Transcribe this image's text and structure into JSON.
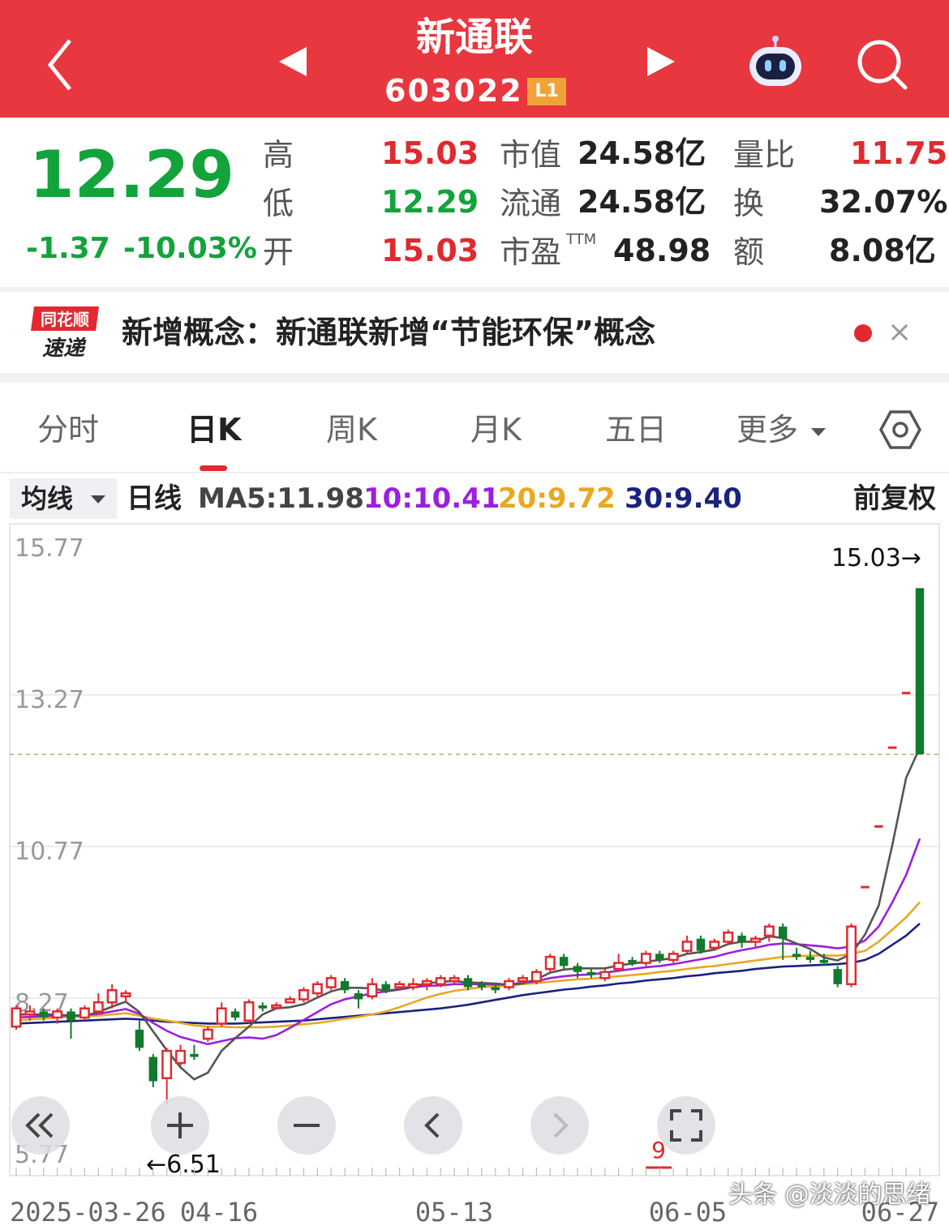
{
  "header": {
    "stock_name": "新通联",
    "stock_code": "603022",
    "level_badge": "L1",
    "back_icon": "back-chevron-icon",
    "prev_icon": "prev-triangle-icon",
    "next_icon": "next-triangle-icon",
    "robot_icon": "ai-robot-icon",
    "search_icon": "search-icon",
    "bg_color": "#e8373e"
  },
  "quote": {
    "last_price": "12.29",
    "change": "-1.37",
    "change_pct": "-10.03%",
    "high_label": "高",
    "high": "15.03",
    "low_label": "低",
    "low": "12.29",
    "open_label": "开",
    "open": "15.03",
    "mktcap_label": "市值",
    "mktcap": "24.58亿",
    "float_label": "流通",
    "float_cap": "24.58亿",
    "pe_label": "市盈",
    "pe_sup": "TTM",
    "pe": "48.98",
    "vol_ratio_label": "量比",
    "vol_ratio": "11.75",
    "turnover_label": "换",
    "turnover": "32.07%",
    "amount_label": "额",
    "amount": "8.08亿",
    "up_color": "#e02a2f",
    "down_color": "#13a33b"
  },
  "news": {
    "logo_top": "同花顺",
    "logo_bottom": "速递",
    "text": "新增概念：新通联新增“节能环保”概念",
    "close_glyph": "×"
  },
  "tabs": [
    {
      "label": "分时",
      "active": false
    },
    {
      "label": "日K",
      "active": true
    },
    {
      "label": "周K",
      "active": false
    },
    {
      "label": "月K",
      "active": false
    },
    {
      "label": "五日",
      "active": false
    },
    {
      "label": "更多",
      "active": false
    }
  ],
  "ma_bar": {
    "selector": "均线",
    "period": "日线",
    "ma5": "MA5:11.98",
    "ma10": "10:10.41",
    "ma20": "20:9.72",
    "ma30": "30:9.40",
    "adjust": "前复权",
    "ma5_color": "#555555",
    "ma10_color": "#9b1fe0",
    "ma20_color": "#e8a820",
    "ma30_color": "#1a2280"
  },
  "chart_data": {
    "type": "candlestick",
    "y_ticks": [
      "15.77",
      "13.27",
      "10.77",
      "8.27",
      "5.77"
    ],
    "ylim": [
      5.77,
      15.77
    ],
    "x_labels": [
      "2025-03-26",
      "04-16",
      "05-13",
      "06-05",
      "06-27"
    ],
    "max_label": "15.03→",
    "min_label": "←6.51",
    "last_close_line": 12.29,
    "marker": "9",
    "candles": [
      [
        7.8,
        8.1,
        7.75,
        8.15
      ],
      [
        8.0,
        8.05,
        7.9,
        8.15
      ],
      [
        8.05,
        7.95,
        7.9,
        8.1
      ],
      [
        7.95,
        8.05,
        7.85,
        8.1
      ],
      [
        8.05,
        7.9,
        7.6,
        8.1
      ],
      [
        7.95,
        8.1,
        7.9,
        8.15
      ],
      [
        8.05,
        8.2,
        8.0,
        8.35
      ],
      [
        8.2,
        8.4,
        8.1,
        8.5
      ],
      [
        8.3,
        8.35,
        8.2,
        8.4
      ],
      [
        7.75,
        7.45,
        7.4,
        7.9
      ],
      [
        7.3,
        6.9,
        6.8,
        7.35
      ],
      [
        6.95,
        7.4,
        6.51,
        7.45
      ],
      [
        7.2,
        7.4,
        7.15,
        7.5
      ],
      [
        7.35,
        7.3,
        7.25,
        7.5
      ],
      [
        7.6,
        7.75,
        7.55,
        7.8
      ],
      [
        7.85,
        8.1,
        7.8,
        8.2
      ],
      [
        8.05,
        7.95,
        7.9,
        8.1
      ],
      [
        7.9,
        8.2,
        7.85,
        8.25
      ],
      [
        8.15,
        8.1,
        8.05,
        8.2
      ],
      [
        8.15,
        8.15,
        8.1,
        8.2
      ],
      [
        8.2,
        8.25,
        8.2,
        8.3
      ],
      [
        8.25,
        8.4,
        8.2,
        8.45
      ],
      [
        8.35,
        8.5,
        8.3,
        8.55
      ],
      [
        8.45,
        8.6,
        8.4,
        8.65
      ],
      [
        8.55,
        8.4,
        8.35,
        8.6
      ],
      [
        8.35,
        8.25,
        8.1,
        8.4
      ],
      [
        8.3,
        8.5,
        8.25,
        8.6
      ],
      [
        8.5,
        8.4,
        8.35,
        8.55
      ],
      [
        8.45,
        8.5,
        8.4,
        8.55
      ],
      [
        8.45,
        8.5,
        8.4,
        8.6
      ],
      [
        8.5,
        8.55,
        8.4,
        8.6
      ],
      [
        8.5,
        8.6,
        8.45,
        8.65
      ],
      [
        8.55,
        8.6,
        8.5,
        8.65
      ],
      [
        8.6,
        8.45,
        8.4,
        8.65
      ],
      [
        8.5,
        8.45,
        8.4,
        8.55
      ],
      [
        8.45,
        8.4,
        8.35,
        8.5
      ],
      [
        8.45,
        8.55,
        8.4,
        8.6
      ],
      [
        8.55,
        8.6,
        8.5,
        8.65
      ],
      [
        8.55,
        8.7,
        8.5,
        8.75
      ],
      [
        8.75,
        8.95,
        8.7,
        9.0
      ],
      [
        8.95,
        8.8,
        8.75,
        9.0
      ],
      [
        8.8,
        8.7,
        8.6,
        8.85
      ],
      [
        8.7,
        8.65,
        8.6,
        8.75
      ],
      [
        8.6,
        8.7,
        8.55,
        8.75
      ],
      [
        8.75,
        8.85,
        8.7,
        9.0
      ],
      [
        8.9,
        8.85,
        8.8,
        8.95
      ],
      [
        8.85,
        9.0,
        8.8,
        9.05
      ],
      [
        9.0,
        8.9,
        8.85,
        9.05
      ],
      [
        8.9,
        9.0,
        8.85,
        9.05
      ],
      [
        9.05,
        9.2,
        9.0,
        9.3
      ],
      [
        9.25,
        9.05,
        9.0,
        9.3
      ],
      [
        9.1,
        9.2,
        9.05,
        9.25
      ],
      [
        9.2,
        9.35,
        9.15,
        9.4
      ],
      [
        9.3,
        9.2,
        9.1,
        9.35
      ],
      [
        9.2,
        9.25,
        9.1,
        9.3
      ],
      [
        9.3,
        9.45,
        9.2,
        9.5
      ],
      [
        9.45,
        9.25,
        8.9,
        9.5
      ],
      [
        9.0,
        8.95,
        8.9,
        9.1
      ],
      [
        8.95,
        8.9,
        8.85,
        9.05
      ],
      [
        8.9,
        8.85,
        8.8,
        9.0
      ],
      [
        8.75,
        8.5,
        8.45,
        8.8
      ],
      [
        8.5,
        9.45,
        8.45,
        9.5
      ],
      [
        10.1,
        10.1,
        10.1,
        10.1
      ],
      [
        11.1,
        11.1,
        11.1,
        11.1
      ],
      [
        12.4,
        12.4,
        12.4,
        12.4
      ],
      [
        13.3,
        13.3,
        13.3,
        13.3
      ],
      [
        15.03,
        12.29,
        12.29,
        15.03
      ]
    ],
    "ma5": [
      8.0,
      8.0,
      8.0,
      8.0,
      7.98,
      7.98,
      8.04,
      8.13,
      8.21,
      8.04,
      7.72,
      7.41,
      7.13,
      6.93,
      7.04,
      7.4,
      7.61,
      7.8,
      8.0,
      8.1,
      8.12,
      8.17,
      8.28,
      8.38,
      8.44,
      8.44,
      8.43,
      8.39,
      8.42,
      8.47,
      8.51,
      8.54,
      8.55,
      8.53,
      8.52,
      8.51,
      8.49,
      8.51,
      8.58,
      8.69,
      8.74,
      8.76,
      8.76,
      8.76,
      8.81,
      8.84,
      8.87,
      8.9,
      8.93,
      9.0,
      9.03,
      9.07,
      9.16,
      9.2,
      9.2,
      9.29,
      9.26,
      9.17,
      9.08,
      8.94,
      8.89,
      9.0,
      9.32,
      9.8,
      10.8,
      11.9,
      12.4
    ],
    "ma10": [
      7.95,
      7.96,
      7.97,
      7.98,
      7.98,
      7.99,
      8.01,
      8.05,
      8.09,
      8.01,
      7.86,
      7.73,
      7.63,
      7.57,
      7.51,
      7.56,
      7.61,
      7.62,
      7.6,
      7.66,
      7.78,
      7.91,
      8.04,
      8.17,
      8.25,
      8.3,
      8.35,
      8.38,
      8.41,
      8.45,
      8.47,
      8.48,
      8.5,
      8.5,
      8.5,
      8.49,
      8.5,
      8.52,
      8.55,
      8.6,
      8.63,
      8.65,
      8.66,
      8.69,
      8.72,
      8.75,
      8.78,
      8.8,
      8.83,
      8.87,
      8.91,
      8.95,
      9.01,
      9.06,
      9.1,
      9.15,
      9.17,
      9.16,
      9.14,
      9.12,
      9.09,
      9.12,
      9.22,
      9.45,
      9.85,
      10.3,
      10.9
    ],
    "ma20": [
      7.9,
      7.92,
      7.93,
      7.95,
      7.96,
      7.97,
      7.98,
      8.0,
      8.02,
      7.98,
      7.93,
      7.9,
      7.86,
      7.82,
      7.8,
      7.8,
      7.79,
      7.79,
      7.79,
      7.8,
      7.82,
      7.84,
      7.86,
      7.89,
      7.93,
      7.96,
      8.0,
      8.05,
      8.12,
      8.2,
      8.28,
      8.34,
      8.39,
      8.42,
      8.45,
      8.46,
      8.48,
      8.5,
      8.52,
      8.54,
      8.56,
      8.58,
      8.59,
      8.61,
      8.63,
      8.65,
      8.67,
      8.7,
      8.72,
      8.75,
      8.78,
      8.8,
      8.83,
      8.86,
      8.89,
      8.92,
      8.95,
      8.96,
      8.97,
      8.97,
      8.97,
      9.0,
      9.05,
      9.2,
      9.4,
      9.6,
      9.85
    ],
    "ma30": [
      7.85,
      7.86,
      7.87,
      7.88,
      7.89,
      7.9,
      7.91,
      7.92,
      7.93,
      7.92,
      7.9,
      7.88,
      7.87,
      7.86,
      7.85,
      7.85,
      7.85,
      7.86,
      7.87,
      7.88,
      7.89,
      7.9,
      7.92,
      7.94,
      7.96,
      7.98,
      8.0,
      8.02,
      8.04,
      8.06,
      8.08,
      8.1,
      8.13,
      8.16,
      8.2,
      8.24,
      8.28,
      8.32,
      8.35,
      8.38,
      8.41,
      8.43,
      8.46,
      8.48,
      8.51,
      8.53,
      8.56,
      8.58,
      8.6,
      8.63,
      8.65,
      8.68,
      8.7,
      8.72,
      8.75,
      8.77,
      8.79,
      8.8,
      8.81,
      8.82,
      8.83,
      8.85,
      8.9,
      9.0,
      9.15,
      9.3,
      9.5
    ]
  },
  "controls": [
    {
      "name": "scroll-left-button",
      "icon": "double-chevron-left-icon"
    },
    {
      "name": "zoom-in-button",
      "icon": "plus-icon"
    },
    {
      "name": "zoom-out-button",
      "icon": "minus-icon"
    },
    {
      "name": "prev-button",
      "icon": "chevron-left-icon"
    },
    {
      "name": "next-button",
      "icon": "chevron-right-icon"
    },
    {
      "name": "fullscreen-button",
      "icon": "fullscreen-icon"
    }
  ],
  "watermark": "头条 @淡淡的思绪"
}
